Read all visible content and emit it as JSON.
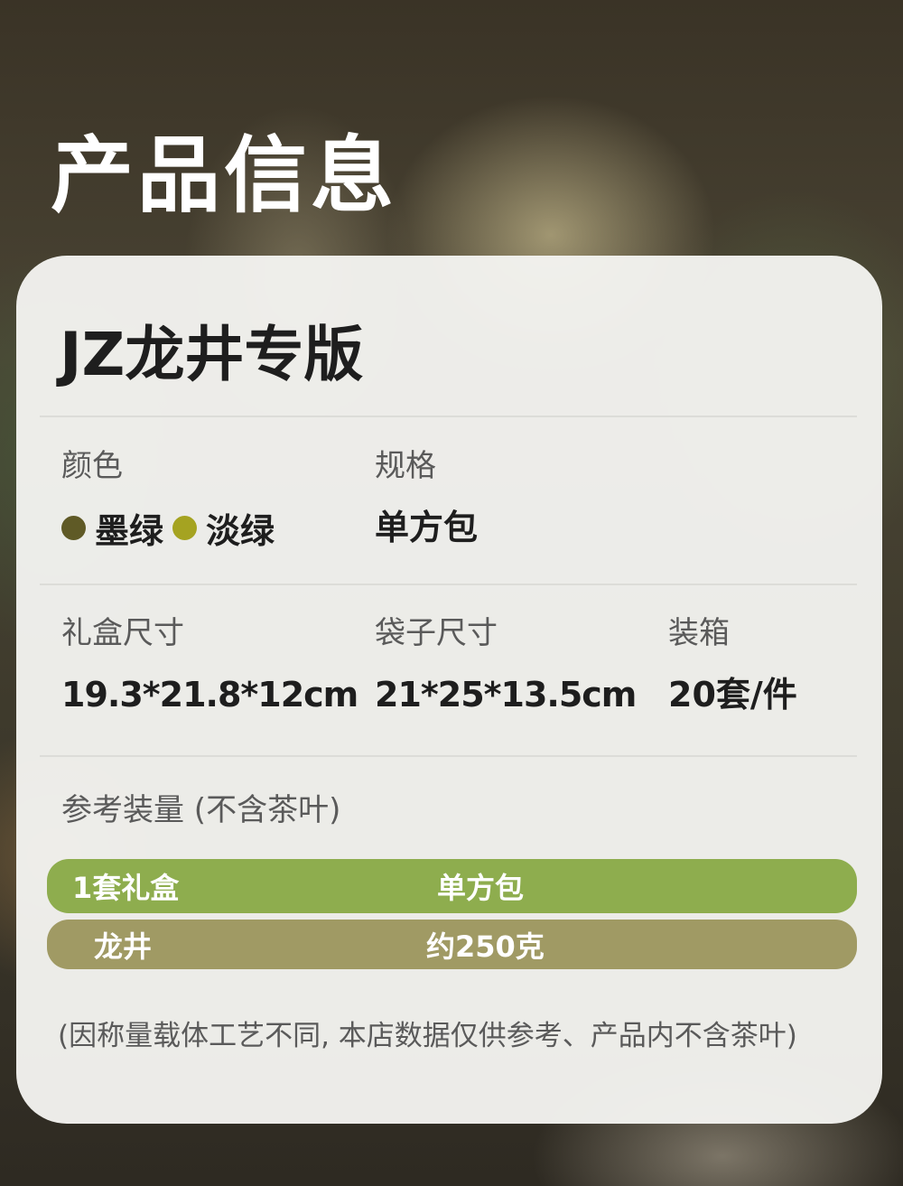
{
  "page_title": "产品信息",
  "product_name": "JZ龙井专版",
  "specs": {
    "color_label": "颜色",
    "colors": [
      {
        "name": "墨绿",
        "hex": "#5f5a26"
      },
      {
        "name": "淡绿",
        "hex": "#a5a321"
      }
    ],
    "spec_label": "规格",
    "spec_value": "单方包",
    "giftbox_label": "礼盒尺寸",
    "giftbox_value": "19.3*21.8*12cm",
    "bag_label": "袋子尺寸",
    "bag_value": "21*25*13.5cm",
    "carton_label": "装箱",
    "carton_value": "20套/件"
  },
  "capacity": {
    "label": "参考装量 (不含茶叶)",
    "rows": [
      {
        "left": "1套礼盒",
        "right": "单方包",
        "color": "#8ead4e"
      },
      {
        "left": "龙井",
        "right": "约250克",
        "color": "#a09a64"
      }
    ]
  },
  "footnote": "(因称量载体工艺不同, 本店数据仅供参考、产品内不含茶叶)"
}
